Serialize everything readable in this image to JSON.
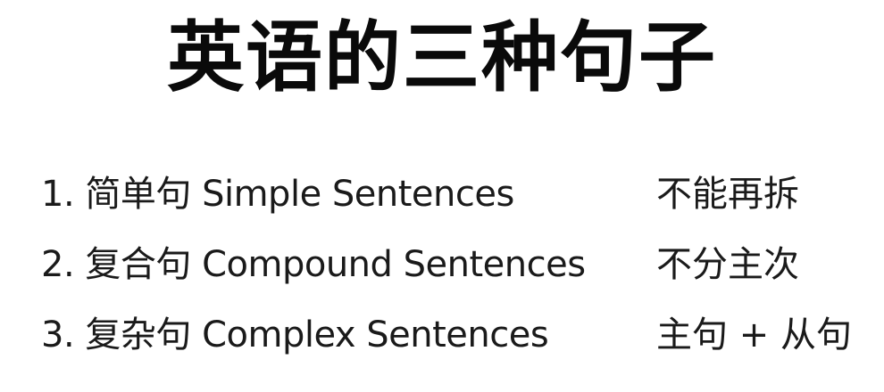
{
  "title": "英语的三种句子",
  "items": [
    {
      "text": "1. 简单句 Simple Sentences",
      "note": "不能再拆"
    },
    {
      "text": "2. 复合句 Compound Sentences",
      "note": "不分主次"
    },
    {
      "text": "3. 复杂句 Complex Sentences",
      "note": "主句 + 从句"
    }
  ]
}
